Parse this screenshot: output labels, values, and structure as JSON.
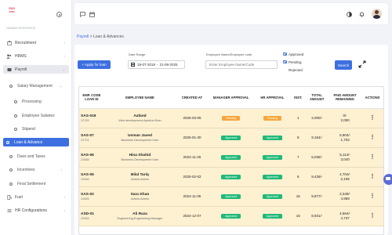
{
  "brand": {
    "logo_text": "SSS",
    "logo_sub": "HRMS"
  },
  "sidebar": {
    "section_title": "HUMAN RESOURCE",
    "items": [
      {
        "label": "Recruitment",
        "icon": "recruitment-icon"
      },
      {
        "label": "HRMS",
        "icon": "hrms-icon"
      },
      {
        "label": "Payroll",
        "icon": "payroll-icon"
      },
      {
        "label": "Salary Management",
        "icon": "bullet-icon"
      },
      {
        "label": "Processing",
        "icon": "bullet-icon"
      },
      {
        "label": "Employee Salaries",
        "icon": "bullet-icon"
      },
      {
        "label": "Stipend",
        "icon": "bullet-icon"
      },
      {
        "label": "Loan & Advance",
        "icon": "bullet-icon"
      },
      {
        "label": "Dues and Taxes",
        "icon": "bullet-icon"
      },
      {
        "label": "Incentives",
        "icon": "bullet-icon"
      },
      {
        "label": "Final Settlement",
        "icon": "bullet-icon"
      },
      {
        "label": "Fuel",
        "icon": "fuel-icon"
      },
      {
        "label": "HR Configurations",
        "icon": "config-icon"
      }
    ]
  },
  "breadcrumb": {
    "root": "Payroll",
    "separator": ">",
    "current": "Loan & Advances"
  },
  "filters": {
    "apply_label": "+ Apply for loan",
    "date_range_label": "Date Range",
    "date_from": "18-07-2019",
    "date_to": "21-08-2025",
    "date_sep": "-",
    "employee_label": "Employee Name/Employee code",
    "employee_placeholder": "Enter Employee Name/Code",
    "approved_label": "Approved",
    "pending_label": "Pending",
    "rejected_label": "Rejected",
    "search_label": "Search"
  },
  "table": {
    "headers": [
      "EMP. CODE LOAN ID",
      "EMPLOYEE NAME",
      "CREATED AT",
      "MANAGER APPROVAL",
      "HR APPROVAL",
      "INST.",
      "TOTAL AMOUNT",
      "PAID AMOUNT REMAINING",
      "ACTIONS"
    ],
    "rows": [
      {
        "code": "SAS-019",
        "loan_id": "22765",
        "name": "Aafand",
        "designation": "Web development-Ayesha Khan",
        "created": "2025-03-05",
        "manager": "Pending",
        "hr": "Pending",
        "inst": "1",
        "total": "2,000/-",
        "paid": "0/-",
        "remaining": "2,000"
      },
      {
        "code": "SAS-07",
        "loan_id": "22701",
        "name": "Usman Javed",
        "designation": "Business Development User",
        "created": "2025-01-30",
        "manager": "Approved",
        "hr": "Approved",
        "inst": "8",
        "total": "9,164/-",
        "paid": "5,904/-",
        "remaining": "1,703"
      },
      {
        "code": "SAS-06",
        "loan_id": "22688",
        "name": "Hina Shahid",
        "designation": "Business Development User",
        "created": "2024-11-26",
        "manager": "Approved",
        "hr": "Approved",
        "inst": "7",
        "total": "5,036/-",
        "paid": "5,114/-",
        "remaining": "3,040"
      },
      {
        "code": "SAS-05",
        "loan_id": "22686",
        "name": "Bilal Tariq",
        "designation": "Admin-Admin",
        "created": "2025-02-02",
        "manager": "Approved",
        "hr": "Approved",
        "inst": "6",
        "total": "9,436/-",
        "paid": "4,704/-",
        "remaining": "2,105"
      },
      {
        "code": "SAS-02",
        "loan_id": "22685",
        "name": "Sara Khan",
        "designation": "Admin-Admin",
        "created": "2024-11-05",
        "manager": "Approved",
        "hr": "Approved",
        "inst": "15",
        "total": "9,877/-",
        "paid": "3,349/-",
        "remaining": "4,959"
      },
      {
        "code": "ASD-01",
        "loan_id": "22684",
        "name": "Ali Raza",
        "designation": "Engineering-Engineering Manager",
        "created": "2024-12-07",
        "manager": "Approved",
        "hr": "Approved",
        "inst": "15",
        "total": "8,931/-",
        "paid": "4,664/-",
        "remaining": "4,737"
      }
    ]
  },
  "colors": {
    "accent": "#3d6fe0",
    "approved": "#1fb978",
    "pending": "#f6a63a",
    "row_bg": "#fdf1d2"
  }
}
